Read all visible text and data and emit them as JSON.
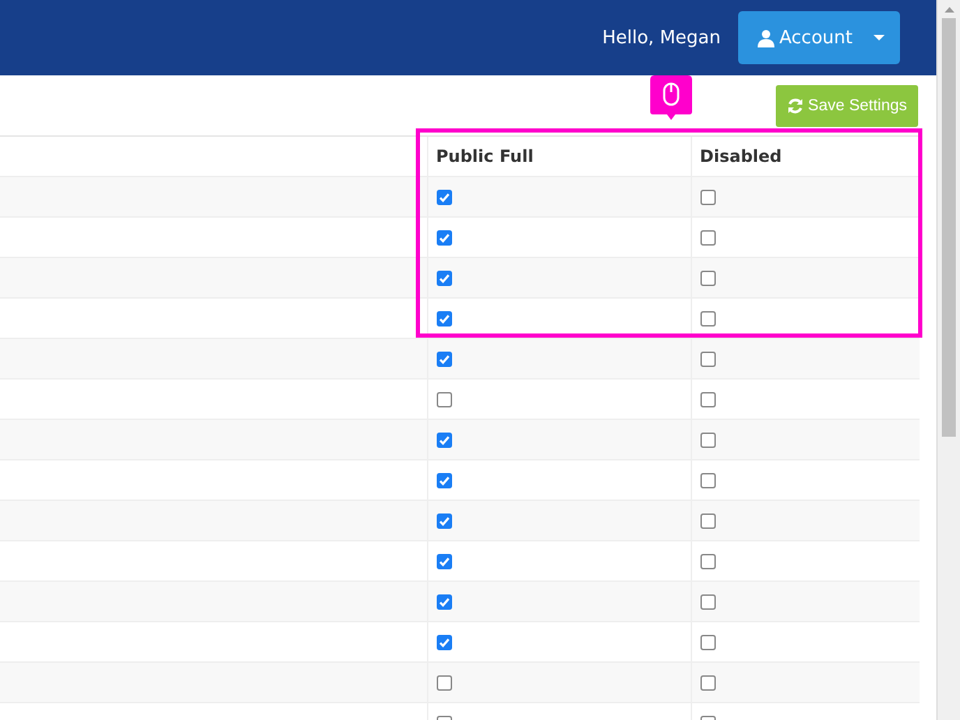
{
  "header": {
    "greeting": "Hello, Megan",
    "account_button": {
      "label": "Account"
    }
  },
  "toolbar": {
    "save_button": {
      "label": "Save Settings"
    }
  },
  "table": {
    "columns": [
      {
        "label": "Public Full"
      },
      {
        "label": "Disabled"
      }
    ],
    "rows": [
      {
        "public_full": {
          "checked": true
        },
        "disabled": {
          "checked": false
        }
      },
      {
        "public_full": {
          "checked": true
        },
        "disabled": {
          "checked": false
        }
      },
      {
        "public_full": {
          "checked": true
        },
        "disabled": {
          "checked": false
        }
      },
      {
        "public_full": {
          "checked": true
        },
        "disabled": {
          "checked": false
        }
      },
      {
        "public_full": {
          "checked": true
        },
        "disabled": {
          "checked": false
        }
      },
      {
        "public_full": {
          "checked": false
        },
        "disabled": {
          "checked": false
        }
      },
      {
        "public_full": {
          "checked": true
        },
        "disabled": {
          "checked": false
        }
      },
      {
        "public_full": {
          "checked": true
        },
        "disabled": {
          "checked": false
        }
      },
      {
        "public_full": {
          "checked": true
        },
        "disabled": {
          "checked": false
        }
      },
      {
        "public_full": {
          "checked": true
        },
        "disabled": {
          "checked": false
        }
      },
      {
        "public_full": {
          "checked": true
        },
        "disabled": {
          "checked": false
        }
      },
      {
        "public_full": {
          "checked": true
        },
        "disabled": {
          "checked": false
        }
      },
      {
        "public_full": {
          "checked": false
        },
        "disabled": {
          "checked": false
        }
      },
      {
        "public_full": {
          "checked": false
        },
        "disabled": {
          "checked": false
        }
      }
    ]
  }
}
